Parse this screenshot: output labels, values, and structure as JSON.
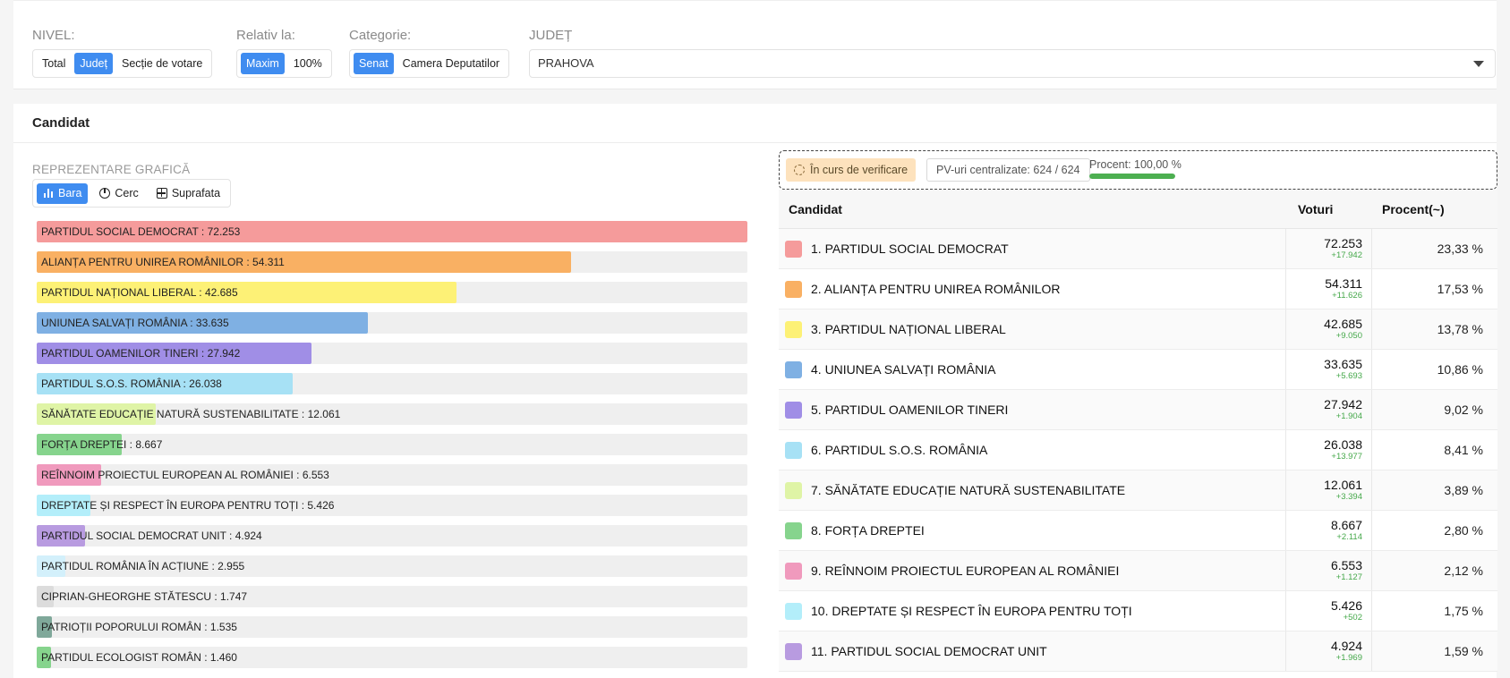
{
  "filters": {
    "nivel": {
      "label": "NIVEL:",
      "options": [
        "Total",
        "Județ",
        "Secție de votare"
      ],
      "active": 1
    },
    "relativ": {
      "label": "Relativ la:",
      "options": [
        "Maxim",
        "100%"
      ],
      "active": 0
    },
    "categorie": {
      "label": "Categorie:",
      "options": [
        "Senat",
        "Camera Deputatilor"
      ],
      "active": 0
    },
    "judet": {
      "label": "JUDEȚ",
      "value": "PRAHOVA"
    }
  },
  "panel_title": "Candidat",
  "representation": {
    "label": "REPREZENTARE GRAFICĂ",
    "bara": "Bara",
    "cerc": "Cerc",
    "suprafata": "Suprafata"
  },
  "status": {
    "verification": "În curs de verificare",
    "pv": "PV-uri centralizate: 624 / 624",
    "percent_label": "Procent: 100,00 %",
    "percent_value": 1.0
  },
  "table_headers": {
    "candidate": "Candidat",
    "votes": "Voturi",
    "percent": "Procent(~)"
  },
  "chart_data": {
    "type": "bar",
    "max": 72253,
    "items": [
      {
        "label": "PARTIDUL SOCIAL DEMOCRAT : 72.253",
        "value": 72253,
        "color": "#f59b9b"
      },
      {
        "label": "ALIANȚA PENTRU UNIREA ROMÂNILOR : 54.311",
        "value": 54311,
        "color": "#f9b063"
      },
      {
        "label": "PARTIDUL NAȚIONAL LIBERAL : 42.685",
        "value": 42685,
        "color": "#fdf176"
      },
      {
        "label": "UNIUNEA SALVAȚI ROMÂNIA : 33.635",
        "value": 33635,
        "color": "#7fb0e3"
      },
      {
        "label": "PARTIDUL OAMENILOR TINERI : 27.942",
        "value": 27942,
        "color": "#a08ee6"
      },
      {
        "label": "PARTIDUL S.O.S. ROMÂNIA : 26.038",
        "value": 26038,
        "color": "#a7e1f5"
      },
      {
        "label": "SĂNĂTATE EDUCAȚIE NATURĂ SUSTENABILITATE : 12.061",
        "value": 12061,
        "color": "#dff4a6"
      },
      {
        "label": "FORȚA DREPTEI : 8.667",
        "value": 8667,
        "color": "#86d48d"
      },
      {
        "label": "REÎNNOIM PROIECTUL EUROPEAN AL ROMÂNIEI : 6.553",
        "value": 6553,
        "color": "#f09abd"
      },
      {
        "label": "DREPTATE ȘI RESPECT ÎN EUROPA PENTRU TOȚI : 5.426",
        "value": 5426,
        "color": "#b3eefa"
      },
      {
        "label": "PARTIDUL SOCIAL DEMOCRAT UNIT : 4.924",
        "value": 4924,
        "color": "#b89be0"
      },
      {
        "label": "PARTIDUL ROMÂNIA ÎN ACȚIUNE : 2.955",
        "value": 2955,
        "color": "#d3f0fb"
      },
      {
        "label": "CIPRIAN-GHEORGHE STĂTESCU : 1.747",
        "value": 1747,
        "color": "#dcdcdc"
      },
      {
        "label": "PATRIOȚII POPORULUI ROMÂN : 1.535",
        "value": 1535,
        "color": "#7fa89a"
      },
      {
        "label": "PARTIDUL ECOLOGIST ROMÂN : 1.460",
        "value": 1460,
        "color": "#86d48d"
      }
    ]
  },
  "table_rows": [
    {
      "name": "1. PARTIDUL SOCIAL DEMOCRAT",
      "votes": "72.253",
      "delta": "+17.942",
      "percent": "23,33 %",
      "color": "#f59b9b"
    },
    {
      "name": "2. ALIANȚA PENTRU UNIREA ROMÂNILOR",
      "votes": "54.311",
      "delta": "+11.626",
      "percent": "17,53 %",
      "color": "#f9b063"
    },
    {
      "name": "3. PARTIDUL NAȚIONAL LIBERAL",
      "votes": "42.685",
      "delta": "+9.050",
      "percent": "13,78 %",
      "color": "#fdf176"
    },
    {
      "name": "4. UNIUNEA SALVAȚI ROMÂNIA",
      "votes": "33.635",
      "delta": "+5.693",
      "percent": "10,86 %",
      "color": "#7fb0e3"
    },
    {
      "name": "5. PARTIDUL OAMENILOR TINERI",
      "votes": "27.942",
      "delta": "+1.904",
      "percent": "9,02 %",
      "color": "#a08ee6"
    },
    {
      "name": "6. PARTIDUL S.O.S. ROMÂNIA",
      "votes": "26.038",
      "delta": "+13.977",
      "percent": "8,41 %",
      "color": "#a7e1f5"
    },
    {
      "name": "7. SĂNĂTATE EDUCAȚIE NATURĂ SUSTENABILITATE",
      "votes": "12.061",
      "delta": "+3.394",
      "percent": "3,89 %",
      "color": "#dff4a6"
    },
    {
      "name": "8. FORȚA DREPTEI",
      "votes": "8.667",
      "delta": "+2.114",
      "percent": "2,80 %",
      "color": "#86d48d"
    },
    {
      "name": "9. REÎNNOIM PROIECTUL EUROPEAN AL ROMÂNIEI",
      "votes": "6.553",
      "delta": "+1.127",
      "percent": "2,12 %",
      "color": "#f09abd"
    },
    {
      "name": "10. DREPTATE ȘI RESPECT ÎN EUROPA PENTRU TOȚI",
      "votes": "5.426",
      "delta": "+502",
      "percent": "1,75 %",
      "color": "#b3eefa"
    },
    {
      "name": "11. PARTIDUL SOCIAL DEMOCRAT UNIT",
      "votes": "4.924",
      "delta": "+1.969",
      "percent": "1,59 %",
      "color": "#b89be0"
    }
  ]
}
